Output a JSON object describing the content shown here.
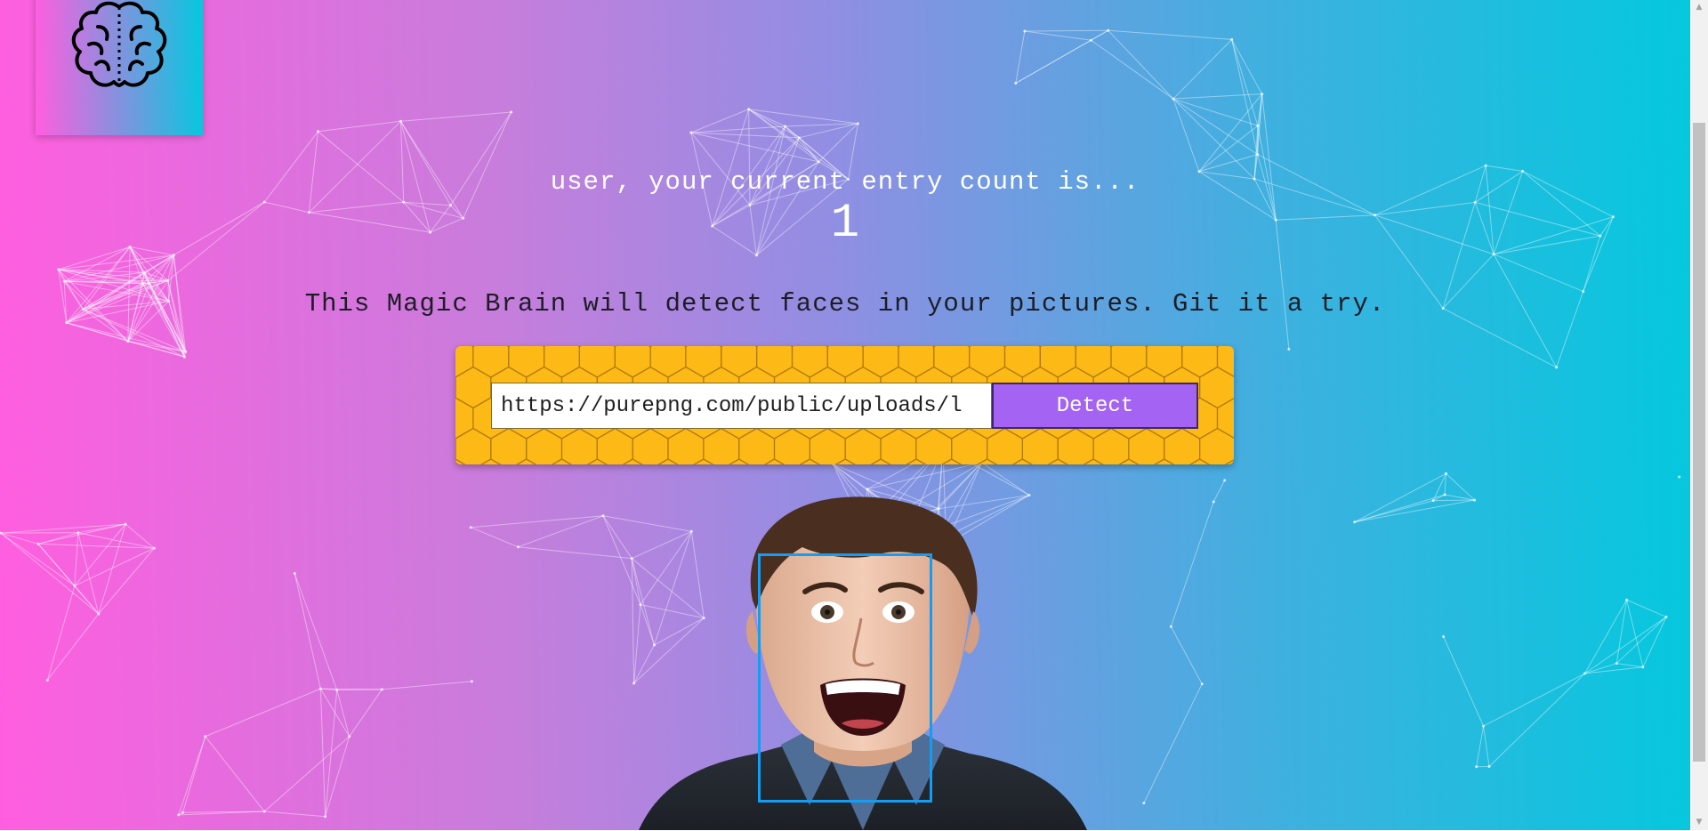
{
  "header": {
    "logo_icon": "brain-icon"
  },
  "rank": {
    "entry_text": "user, your current entry count is...",
    "entry_count": "1"
  },
  "intro": {
    "tagline": "This Magic Brain will detect faces in your pictures. Git it a try."
  },
  "form": {
    "url_value": "https://purepng.com/public/uploads/l",
    "detect_label": "Detect"
  },
  "colors": {
    "gradient_start": "#ff5edf",
    "gradient_end": "#04c8de",
    "panel": "#fdb916",
    "button": "#a463f2",
    "face_box": "#149df2"
  }
}
